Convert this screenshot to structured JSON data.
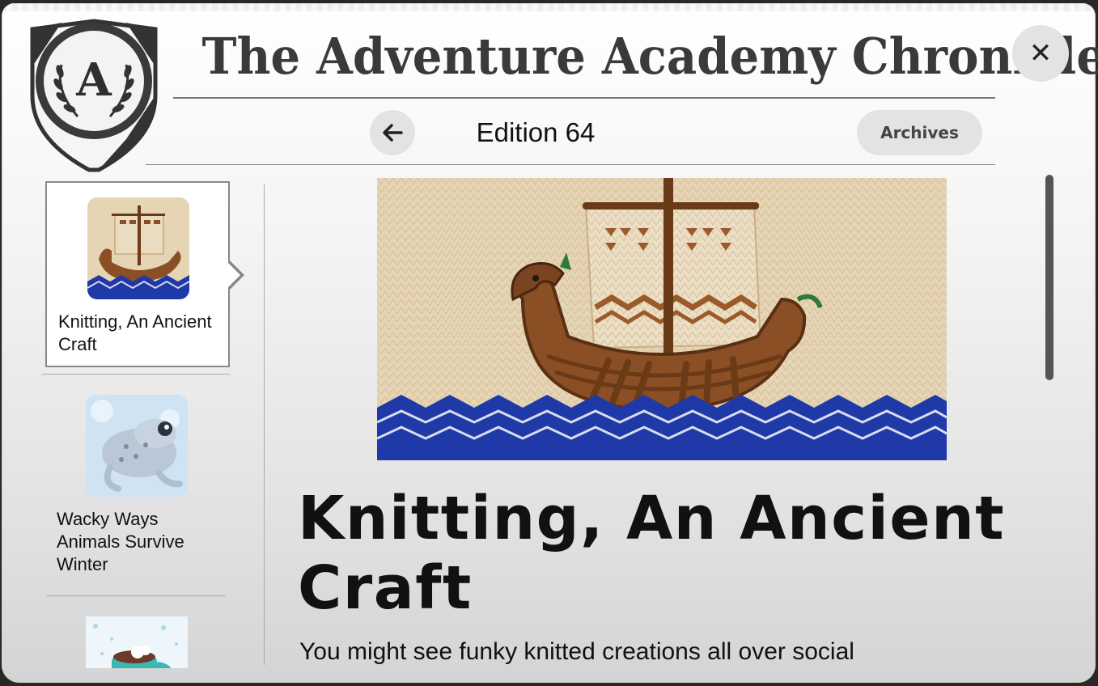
{
  "masthead": {
    "title": "The Adventure Academy Chronicle",
    "crest_letter": "A"
  },
  "header": {
    "edition_label": "Edition 64",
    "archives_label": "Archives",
    "close_symbol": "✕",
    "back_symbol": "🡐"
  },
  "sidebar": {
    "items": [
      {
        "title": "Knitting, An Ancient Craft",
        "thumb_icon": "knitted-viking-ship-icon",
        "active": true
      },
      {
        "title": "Wacky Ways Animals Survive Winter",
        "thumb_icon": "frost-frog-icon",
        "active": false
      },
      {
        "title": "",
        "thumb_icon": "hot-cocoa-mug-icon",
        "active": false
      }
    ]
  },
  "article": {
    "headline": "Knitting, An Ancient Craft",
    "body_first_line": "You might see funky knitted creations all over social",
    "hero_icon": "knitted-viking-ship-icon"
  },
  "colors": {
    "accent_button": "#e3e3e3",
    "masthead_text": "#3a3a3a",
    "knit_background": "#e6d5b5",
    "ship_brown": "#8a4f24",
    "wave_blue": "#1f3aa8"
  }
}
